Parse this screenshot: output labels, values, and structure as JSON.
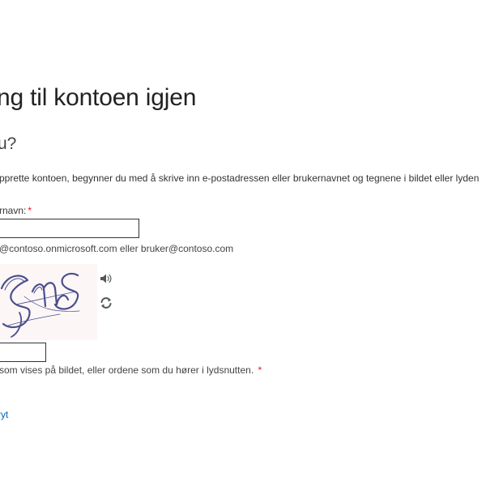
{
  "page": {
    "title": "ng til kontoen igjen",
    "subtitle": "u?",
    "instruction": "pprette kontoen, begynner du med å skrive inn e-postadressen eller brukernavnet og tegnene i bildet eller lyden"
  },
  "email_field": {
    "label": "rnavn:",
    "required_mark": "*",
    "value": "",
    "example": "@contoso.onmicrosoft.com eller bruker@contoso.com"
  },
  "captcha": {
    "image_text": "SMS",
    "audio_icon": "speaker-icon",
    "refresh_icon": "refresh-icon",
    "input_value": "",
    "hint": "som vises på bildet, eller ordene som du hører i lydsnutten.",
    "required_mark": "*"
  },
  "actions": {
    "cancel_label": "ryt"
  },
  "colors": {
    "link": "#0067b8",
    "required": "#e81123",
    "captcha_ink": "#4a4f8c",
    "captcha_bg": "#fcf6f7"
  }
}
